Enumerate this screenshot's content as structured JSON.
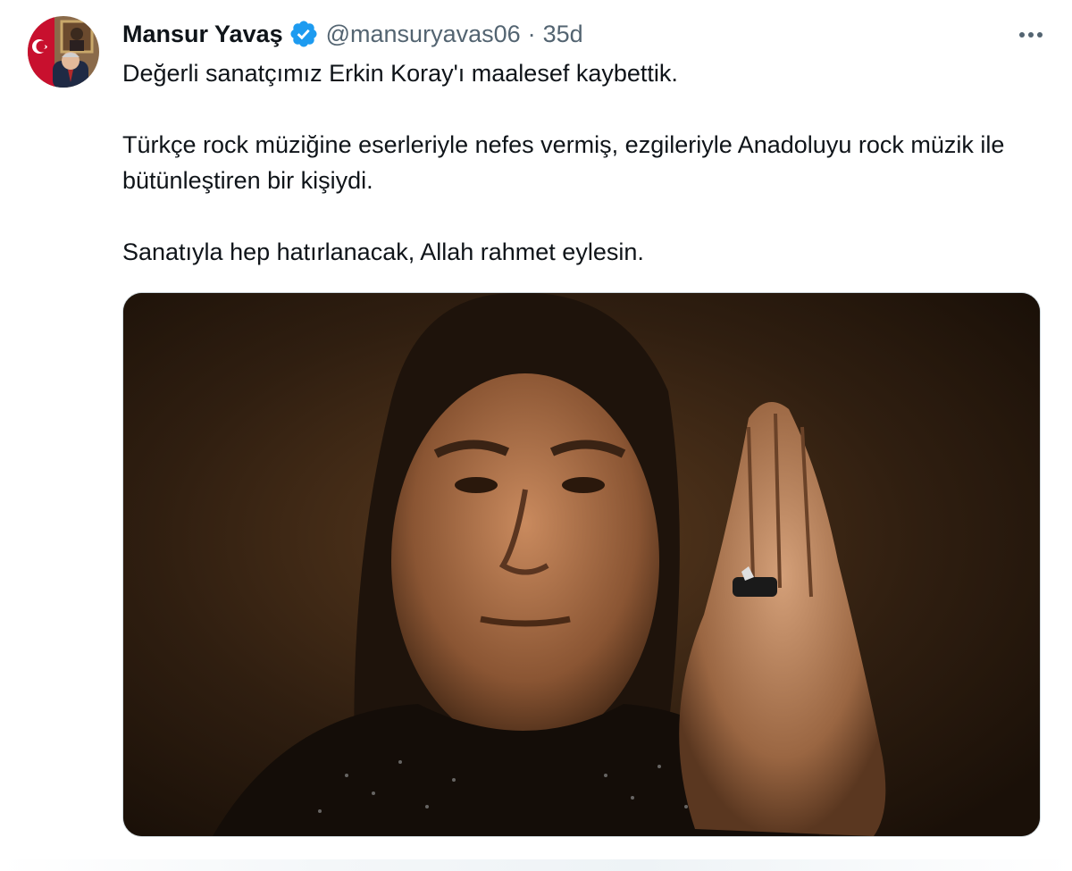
{
  "author": {
    "name": "Mansur Yavaş",
    "handle": "@mansuryavas06",
    "separator": "·",
    "time": "35d",
    "verified_color": "#1d9bf0",
    "avatar_icon": "profile-photo"
  },
  "tweet": {
    "line1": "Değerli sanatçımız Erkin Koray'ı maalesef kaybettik.",
    "line2": "Türkçe rock müziğine eserleriyle nefes vermiş, ezgileriyle Anadoluyu rock müzik ile bütünleştiren bir kişiydi.",
    "line3": "Sanatıyla hep hatırlanacak, Allah rahmet eylesin."
  },
  "actions": {
    "more_icon": "more-dots-icon"
  },
  "media": {
    "type": "photo"
  },
  "colors": {
    "text_primary": "#0f1419",
    "text_secondary": "#536471",
    "border": "#cfd9de"
  }
}
